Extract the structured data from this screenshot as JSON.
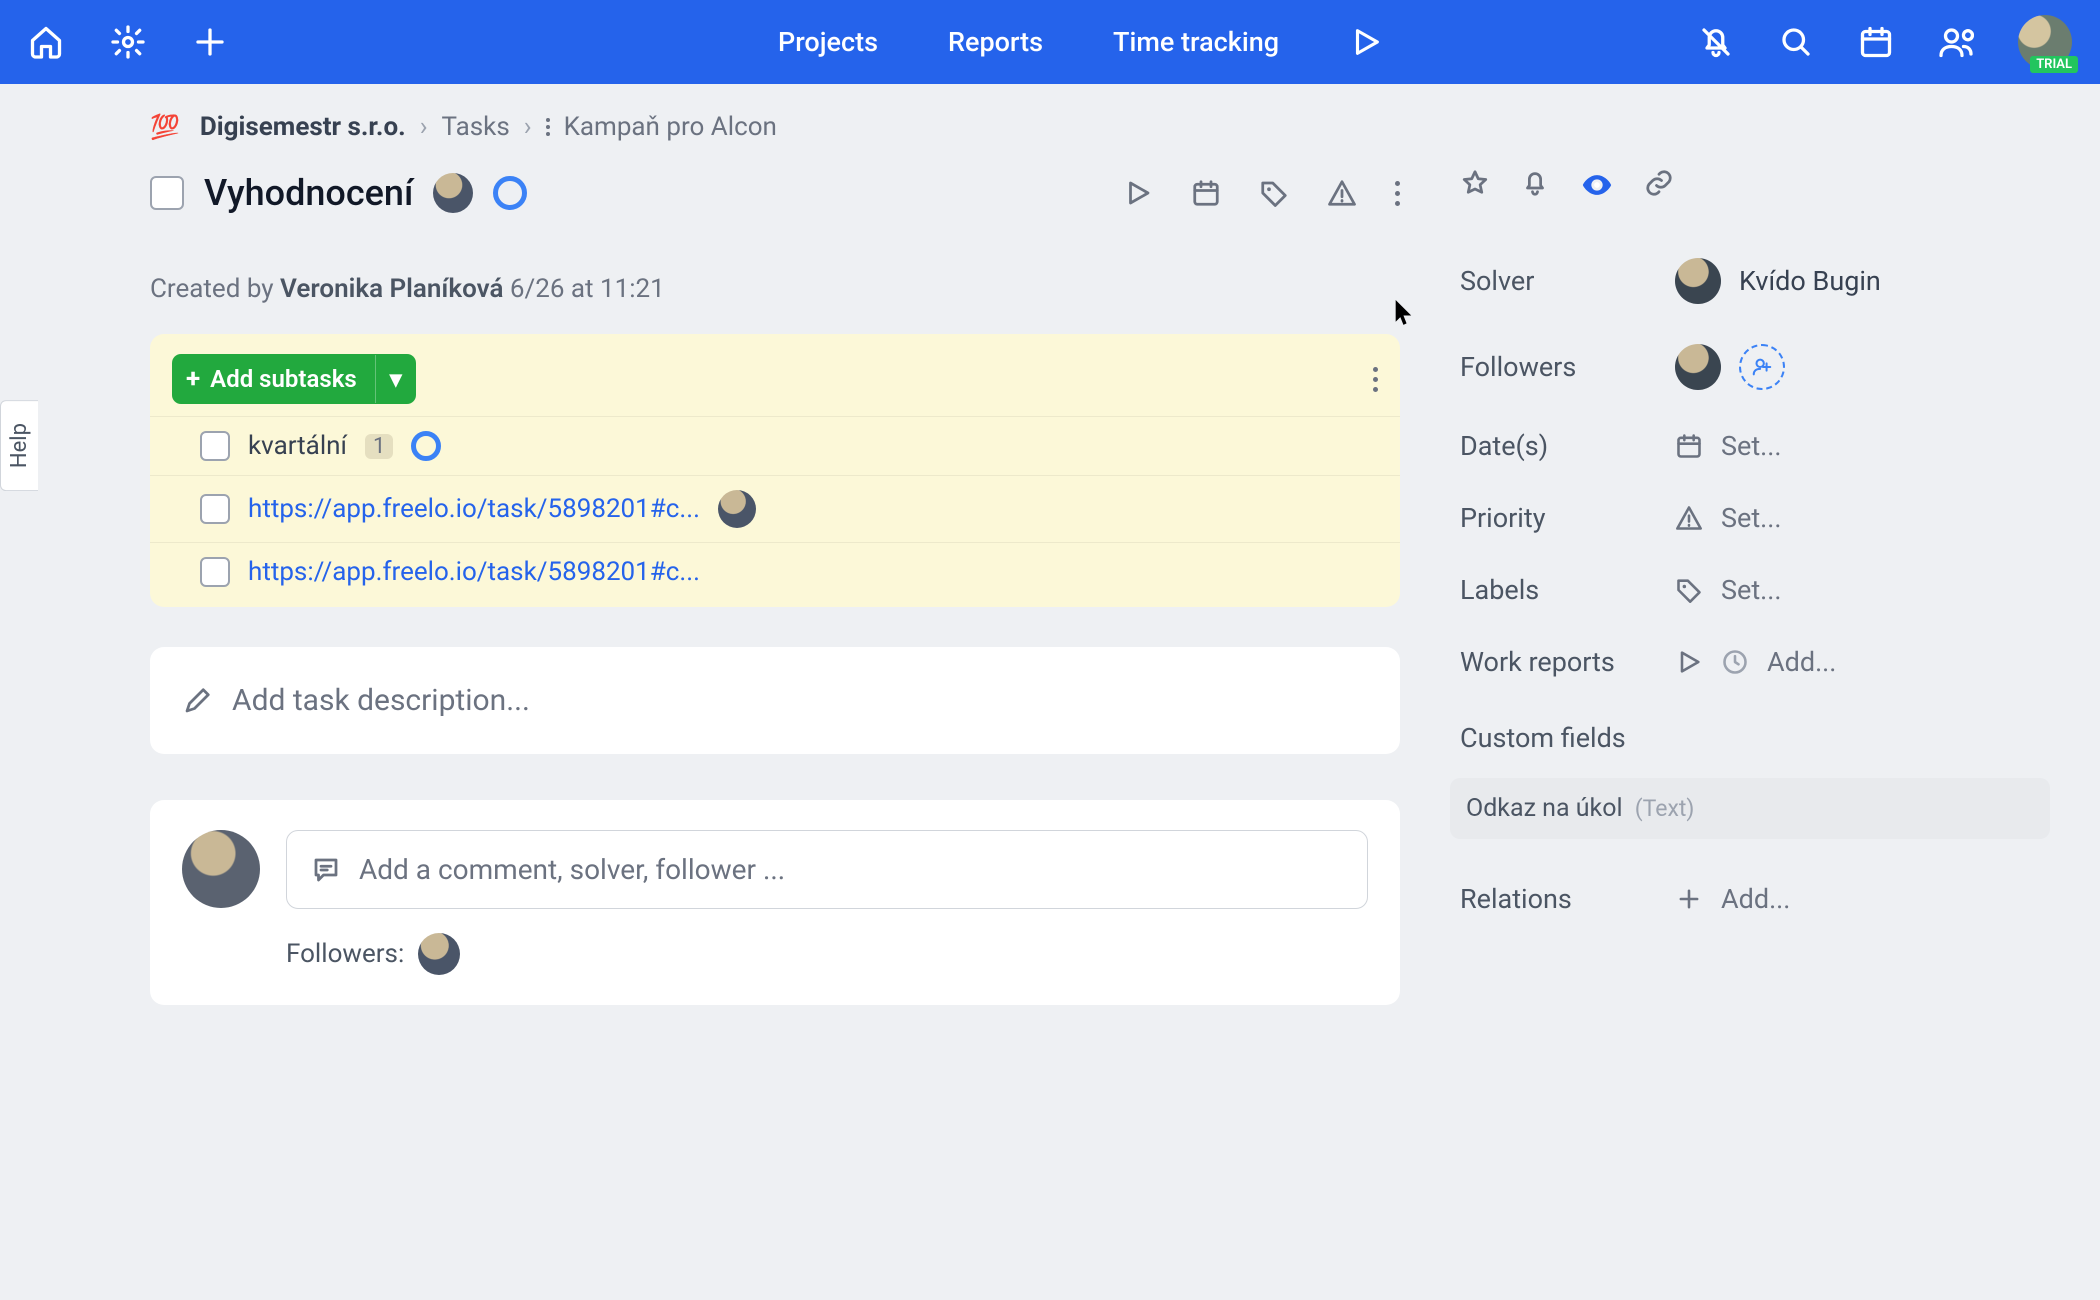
{
  "topnav": {
    "projects": "Projects",
    "reports": "Reports",
    "time_tracking": "Time tracking",
    "trial_badge": "TRIAL"
  },
  "breadcrumb": {
    "emoji": "💯",
    "org": "Digisemestr s.r.o.",
    "tasks": "Tasks",
    "campaign": "Kampaň pro Alcon"
  },
  "task": {
    "title": "Vyhodnocení",
    "created_prefix": "Created by ",
    "created_by": "Veronika Planíková",
    "created_at": " 6/26 at 11:21"
  },
  "subtasks": {
    "add_label": "Add subtasks",
    "items": [
      {
        "text": "kvartální",
        "count": "1",
        "ring": true
      },
      {
        "link": "https://app.freelo.io/task/5898201#c...",
        "avatar": true
      },
      {
        "link": "https://app.freelo.io/task/5898201#c..."
      }
    ]
  },
  "description": {
    "placeholder": "Add task description..."
  },
  "comment": {
    "placeholder": "Add a comment, solver, follower ...",
    "followers_label": "Followers:"
  },
  "sidebar": {
    "solver_label": "Solver",
    "solver_name": "Kvído Bugin",
    "followers_label": "Followers",
    "dates_label": "Date(s)",
    "dates_set": "Set...",
    "priority_label": "Priority",
    "priority_set": "Set...",
    "labels_label": "Labels",
    "labels_set": "Set...",
    "work_label": "Work reports",
    "work_add": "Add...",
    "custom_fields": "Custom fields",
    "cf_name": "Odkaz na úkol",
    "cf_type": "(Text)",
    "relations_label": "Relations",
    "relations_add": "Add..."
  },
  "help": "Help"
}
